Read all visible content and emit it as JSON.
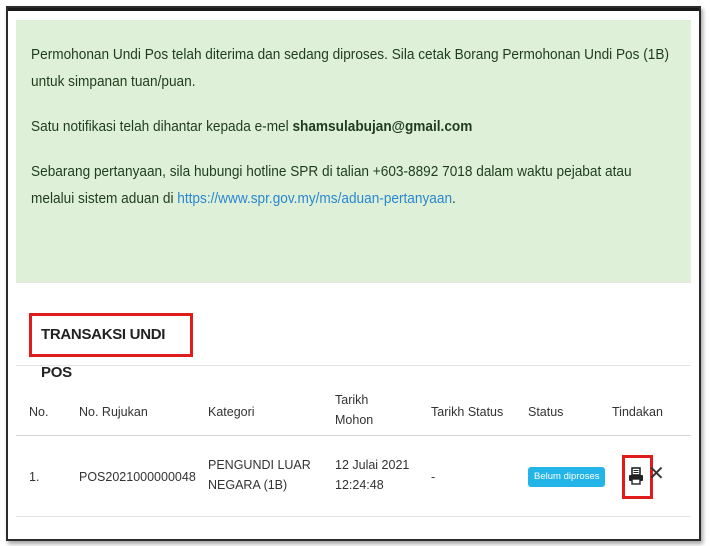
{
  "alert": {
    "line1": "Permohonan Undi Pos telah diterima dan sedang diproses. Sila cetak Borang Permohonan Undi Pos (1B) untuk simpanan tuan/puan.",
    "line2_prefix": "Satu notifikasi telah dihantar kepada e-mel ",
    "email": "shamsulabujan@gmail.com",
    "line3_prefix": "Sebarang pertanyaan, sila hubungi hotline SPR di talian +603-8892 7018 dalam waktu pejabat atau melalui sistem aduan di ",
    "link_text": "https://www.spr.gov.my/ms/aduan-pertanyaan",
    "line3_suffix": "."
  },
  "section": {
    "title": "TRANSAKSI UNDI POS"
  },
  "table": {
    "headers": {
      "no": "No.",
      "rujukan": "No. Rujukan",
      "kategori": "Kategori",
      "tarikh_mohon_1": "Tarikh",
      "tarikh_mohon_2": "Mohon",
      "tarikh_status": "Tarikh Status",
      "status": "Status",
      "tindakan": "Tindakan"
    },
    "rows": [
      {
        "no": "1.",
        "rujukan": "POS2021000000048",
        "kategori_1": "PENGUNDI LUAR",
        "kategori_2": "NEGARA (1B)",
        "tarikh_1": "12 Julai 2021",
        "tarikh_2": "12:24:48",
        "tarikh_status": "-",
        "status": "Belum diproses",
        "print_icon": "printer-icon",
        "close_icon": "close-icon",
        "close_glyph": "✕"
      }
    ]
  },
  "colors": {
    "alert_bg": "#dff0d8",
    "link": "#2a87d0",
    "badge": "#24b5e8",
    "highlight": "#e01b1b"
  }
}
